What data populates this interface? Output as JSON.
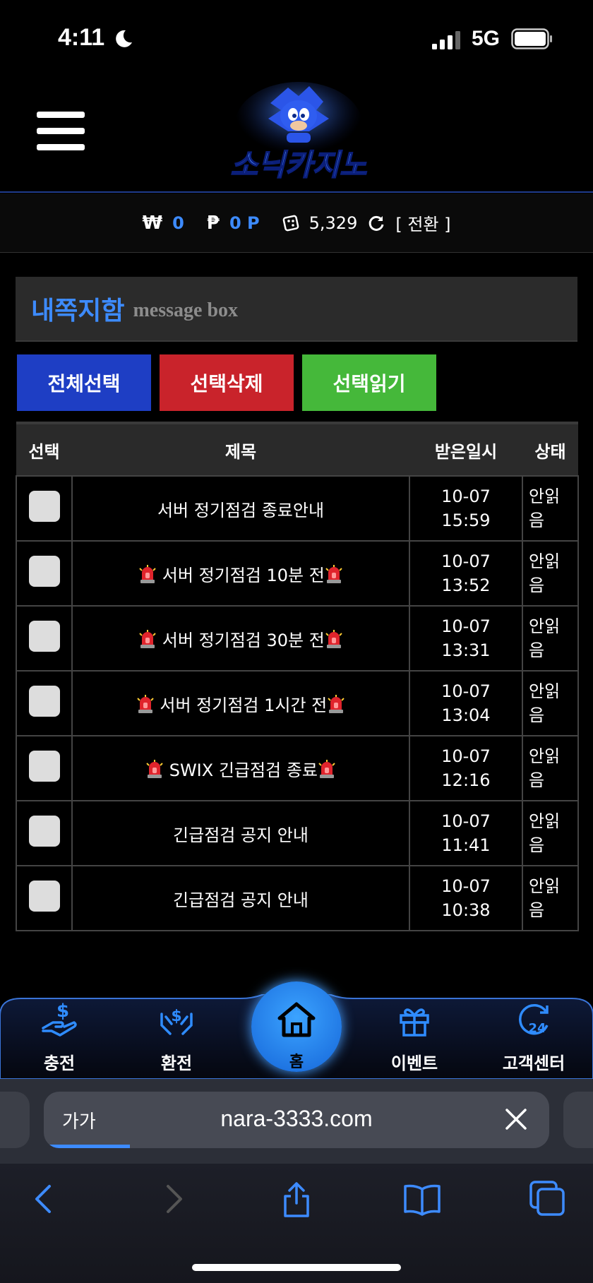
{
  "status_bar": {
    "time": "4:11",
    "network": "5G"
  },
  "header": {
    "logo_text": "소닉카지노"
  },
  "wallet": {
    "won_symbol": "₩",
    "won_value": "0",
    "point_symbol": "₱",
    "point_value": "0 P",
    "chip_value": "5,329",
    "convert_label": "[ 전환 ]"
  },
  "message_box": {
    "title": "내쪽지함",
    "subtitle": "message box"
  },
  "actions": {
    "select_all": "전체선택",
    "delete_selected": "선택삭제",
    "read_selected": "선택읽기"
  },
  "table": {
    "headers": {
      "select": "선택",
      "title": "제목",
      "received": "받은일시",
      "status": "상태"
    },
    "rows": [
      {
        "title": "서버 정기점검 종료안내",
        "siren": false,
        "date": "10-07",
        "time": "15:59",
        "status_1": "안읽",
        "status_2": "음"
      },
      {
        "title": "서버 정기점검 10분 전",
        "siren": true,
        "date": "10-07",
        "time": "13:52",
        "status_1": "안읽",
        "status_2": "음"
      },
      {
        "title": "서버 정기점검 30분 전",
        "siren": true,
        "date": "10-07",
        "time": "13:31",
        "status_1": "안읽",
        "status_2": "음"
      },
      {
        "title": "서버 정기점검 1시간 전",
        "siren": true,
        "date": "10-07",
        "time": "13:04",
        "status_1": "안읽",
        "status_2": "음"
      },
      {
        "title": "SWIX 긴급점검 종료",
        "siren": true,
        "date": "10-07",
        "time": "12:16",
        "status_1": "안읽",
        "status_2": "음"
      },
      {
        "title": "긴급점검 공지 안내",
        "siren": false,
        "date": "10-07",
        "time": "11:41",
        "status_1": "안읽",
        "status_2": "음"
      },
      {
        "title": "긴급점검 공지 안내",
        "siren": false,
        "date": "10-07",
        "time": "10:38",
        "status_1": "안읽",
        "status_2": "음"
      }
    ]
  },
  "bottom_nav": {
    "deposit": "충전",
    "withdraw": "환전",
    "home": "홈",
    "event": "이벤트",
    "support": "고객센터"
  },
  "browser": {
    "aa_label": "가가",
    "url": "nara-3333.com",
    "load_progress": 0.17
  },
  "colors": {
    "accent": "#3d8bff",
    "select_all": "#1e3ec4",
    "delete": "#c9232b",
    "read": "#45b83a"
  }
}
